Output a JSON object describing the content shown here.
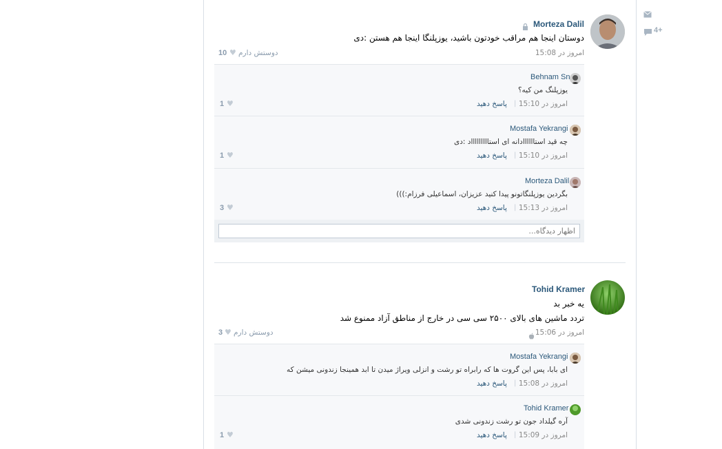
{
  "sidebar": {
    "mail_icon": "envelope-icon",
    "comments_icon": "speech-bubble-icon",
    "comments_count": "4+"
  },
  "posts": [
    {
      "author": "Morteza Dalil",
      "text": "دوستان اینجا هم مراقب خودتون باشید، یوزپلنگا اینجا هم هستن :دی",
      "time": "امروز در 15:08",
      "like_count": "10",
      "like_label": "دوستش دارم",
      "comments": [
        {
          "author": "Behnam Sn",
          "text": "یوزپلنگ من کیه؟",
          "time": "امروز در 15:10",
          "reply": "پاسخ دهید",
          "likes": "1"
        },
        {
          "author": "Mostafa Yekrangi",
          "text": "چه قید استاااااادانه ای استاااااااااد :دی",
          "time": "امروز در 15:10",
          "reply": "پاسخ دهید",
          "likes": "1"
        },
        {
          "author": "Morteza Dalil",
          "text": "بگردین یوزپلنگاتونو پیدا کنید عزیزان، اسماعیلی فرزام:)))",
          "time": "امروز در 15:13",
          "reply": "پاسخ دهید",
          "likes": "3"
        }
      ],
      "comment_placeholder": "اظهار دیدگاه..."
    },
    {
      "author": "Tohid Kramer",
      "text_line1": "یه خبر بد",
      "text_line2": "تردد ماشین های بالای ۲۵۰۰ سی سی در خارج از مناطق آزاد ممنوع شد",
      "time": "امروز در 15:06",
      "like_count": "3",
      "like_label": "دوستش دارم",
      "comments": [
        {
          "author": "Mostafa Yekrangi",
          "text": "ای بابا، پس این گروت ها که رابراه تو رشت و انزلی ویراژ میدن تا ابد همینجا زندونی میشن که",
          "time": "امروز در 15:08",
          "reply": "پاسخ دهید",
          "likes": ""
        },
        {
          "author": "Tohid Kramer",
          "text": "آره گیلداد جون تو رشت زندونی شدی",
          "time": "امروز در 15:09",
          "reply": "پاسخ دهید",
          "likes": "1"
        }
      ]
    }
  ]
}
